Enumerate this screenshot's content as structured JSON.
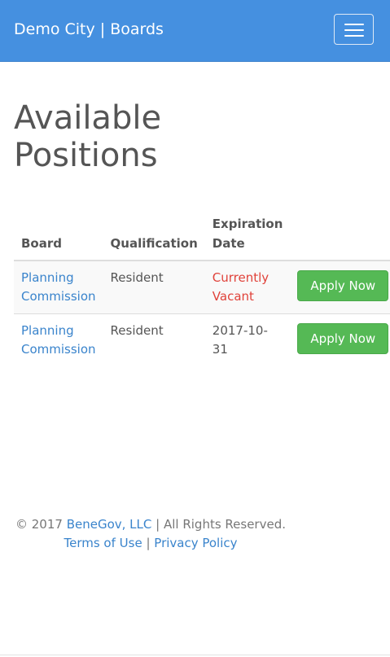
{
  "navbar": {
    "brand": "Demo City | Boards",
    "menu_icon": "hamburger-icon"
  },
  "page": {
    "title_line1": "Available",
    "title_line2": "Positions"
  },
  "table": {
    "headers": {
      "board": "Board",
      "qualification": "Qualification",
      "expiration_line1": "Expiration",
      "expiration_line2": "Date"
    },
    "rows": [
      {
        "board_line1": "Planning",
        "board_line2": "Commission",
        "qualification": "Resident",
        "expiration_line1": "Currently",
        "expiration_line2": "Vacant",
        "action": "Apply Now"
      },
      {
        "board_line1": "Planning",
        "board_line2": "Commission",
        "qualification": "Resident",
        "expiration_line1": "2017-10-",
        "expiration_line2": "31",
        "action": "Apply Now"
      }
    ]
  },
  "footer": {
    "copyright_prefix": "© 2017 ",
    "company": "BeneGov, LLC",
    "rights": " | All Rights Reserved.",
    "terms": "Terms of Use",
    "separator": " | ",
    "privacy": "Privacy Policy"
  },
  "colors": {
    "navbar": "#4590e0",
    "link": "#3a84cc",
    "vacant": "#e0423a",
    "button": "#55b955"
  }
}
